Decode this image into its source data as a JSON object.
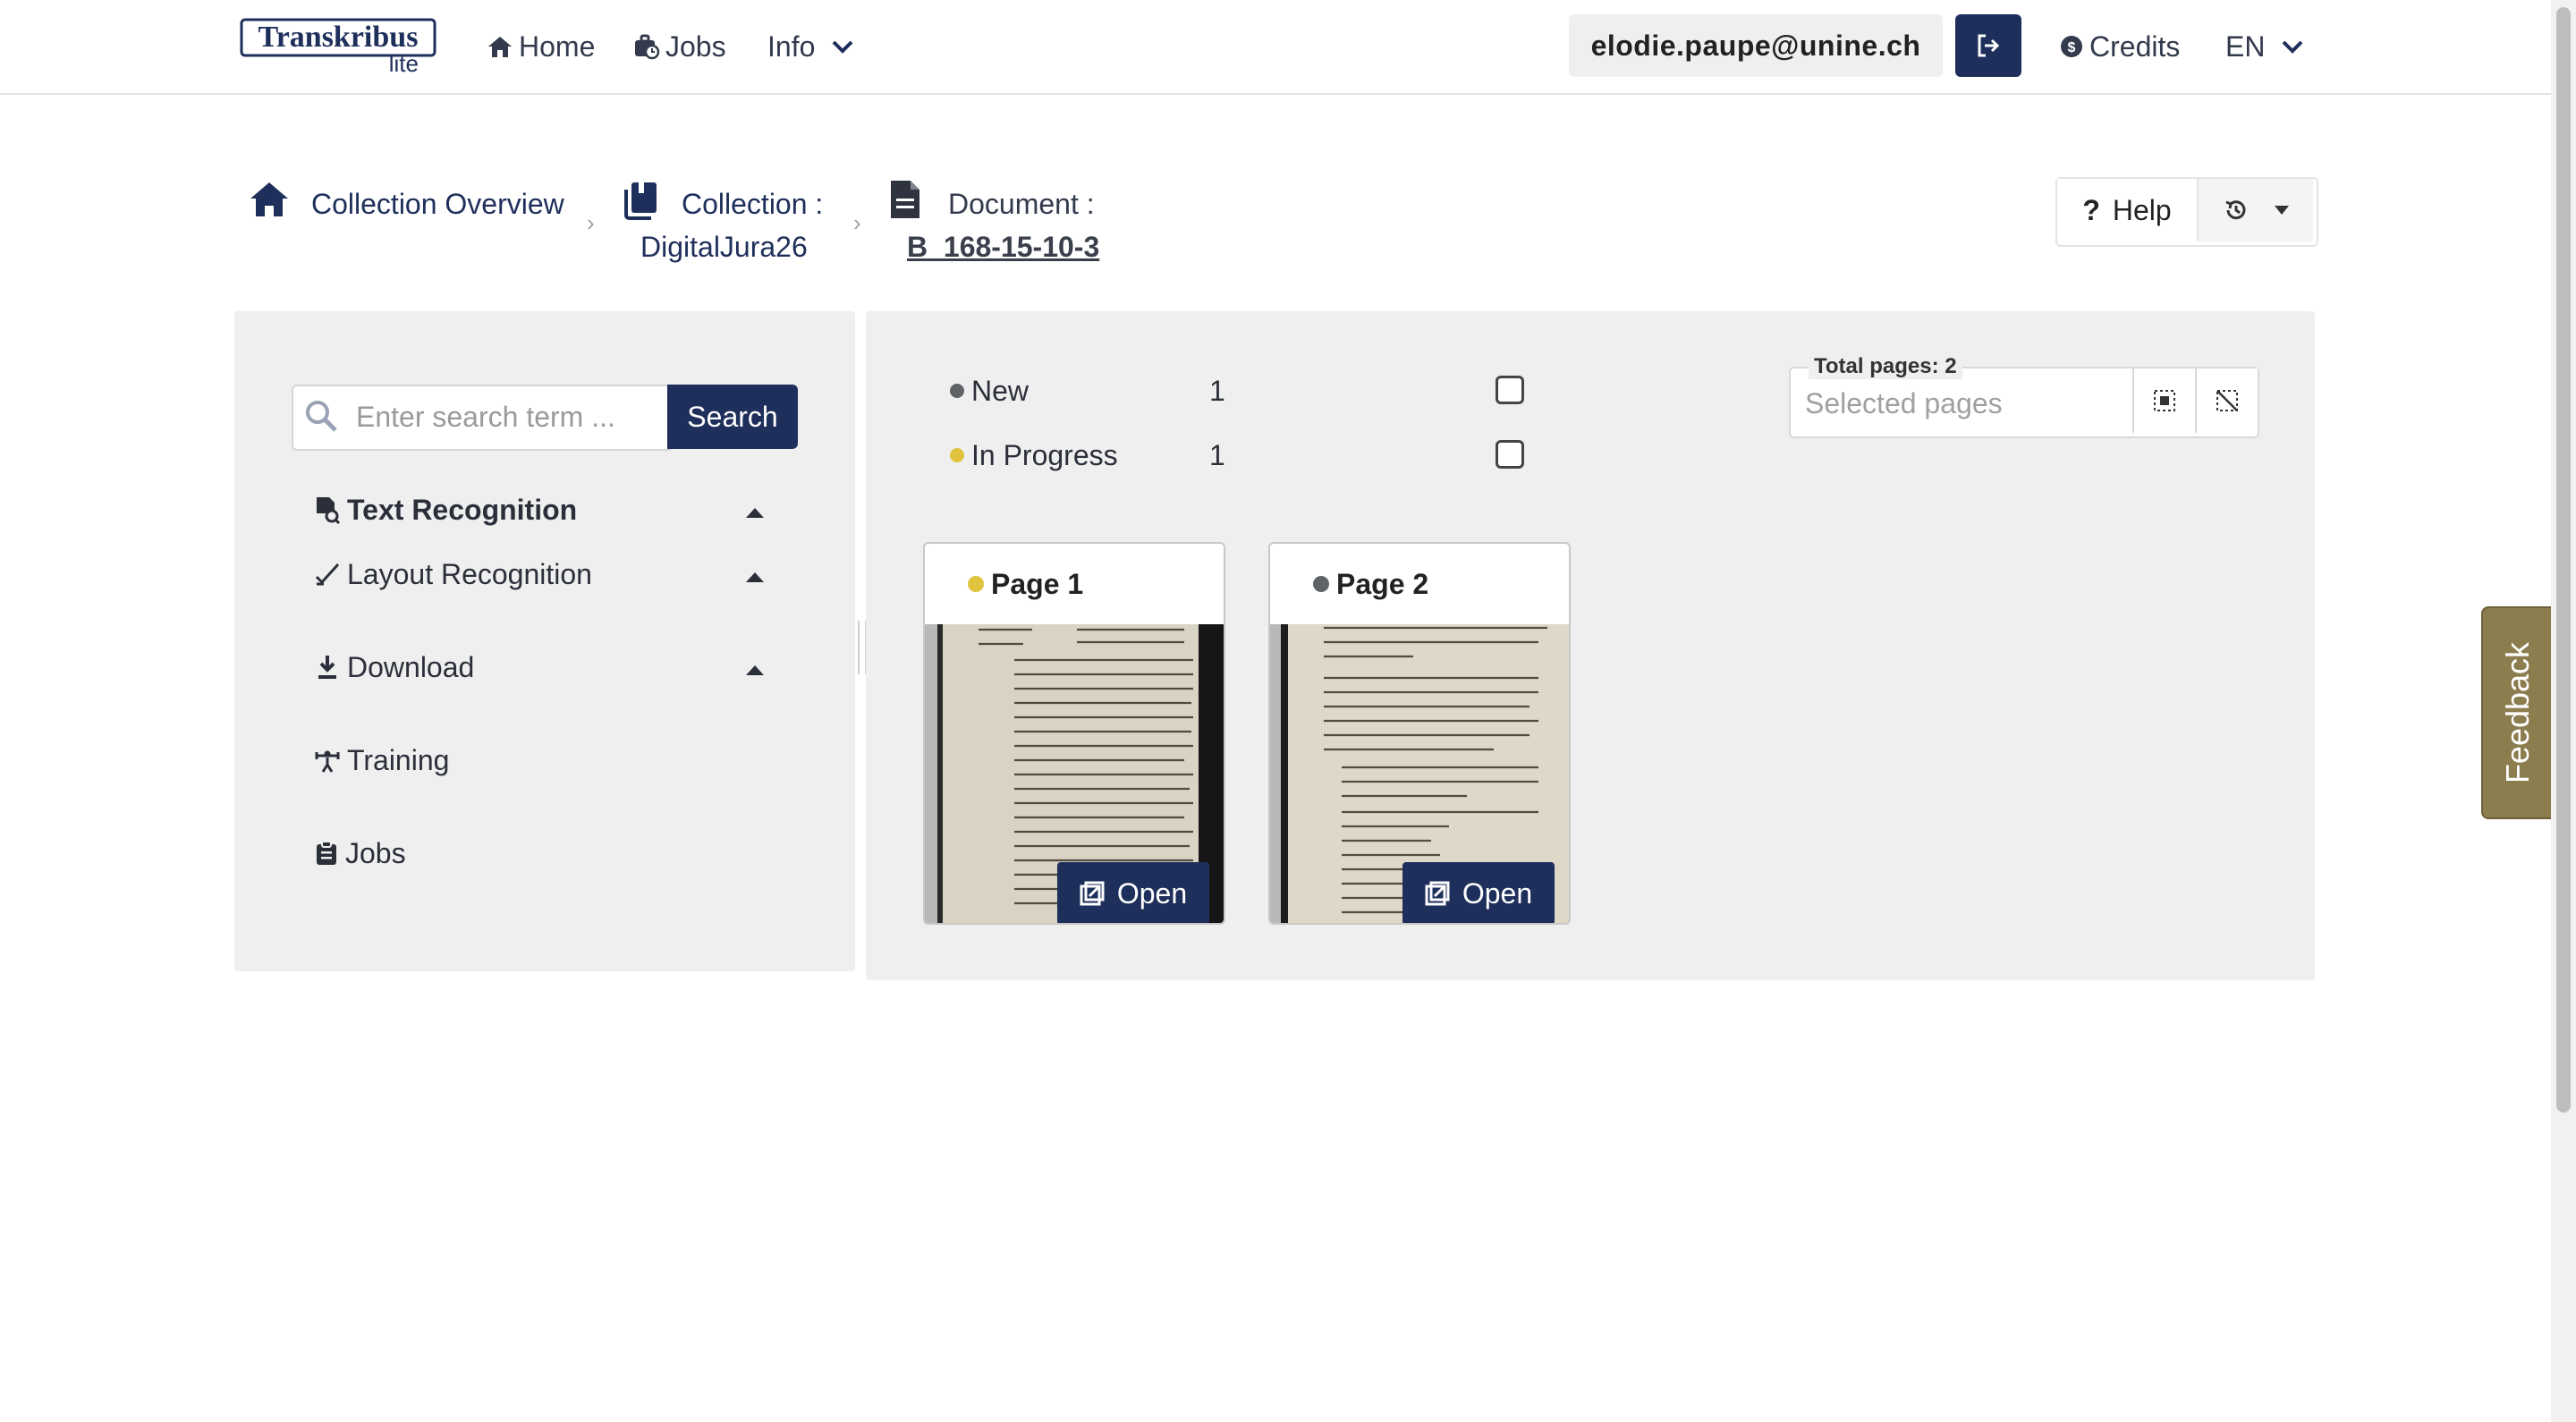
{
  "header": {
    "logo_main": "Transkribus",
    "logo_sub": "lite",
    "nav": {
      "home": "Home",
      "jobs": "Jobs",
      "info": "Info"
    },
    "user_email": "elodie.paupe@unine.ch",
    "credits": "Credits",
    "language": "EN"
  },
  "breadcrumb": {
    "overview": "Collection Overview",
    "collection_label": "Collection :",
    "collection_name": "DigitalJura26",
    "document_label": "Document :",
    "document_name": "B_168-15-10-3",
    "separator": "›"
  },
  "toolbar": {
    "help": "Help"
  },
  "sidebar": {
    "search_placeholder": "Enter search term ...",
    "search_button": "Search",
    "items": [
      {
        "label": "Text Recognition"
      },
      {
        "label": "Layout Recognition"
      },
      {
        "label": "Download"
      },
      {
        "label": "Training"
      },
      {
        "label": "Jobs"
      }
    ]
  },
  "status": [
    {
      "label": "New",
      "count": "1",
      "color": "#5f6368"
    },
    {
      "label": "In Progress",
      "count": "1",
      "color": "#e0c33c"
    }
  ],
  "pages_selector": {
    "legend": "Total pages: 2",
    "placeholder": "Selected pages"
  },
  "pages": [
    {
      "title": "Page 1",
      "status_color": "#e0c33c",
      "open_label": "Open"
    },
    {
      "title": "Page 2",
      "status_color": "#5f6368",
      "open_label": "Open"
    }
  ],
  "feedback": "Feedback",
  "colors": {
    "primary": "#1e2f5b",
    "panel": "#efefef",
    "feedback": "#8b7d4e"
  }
}
